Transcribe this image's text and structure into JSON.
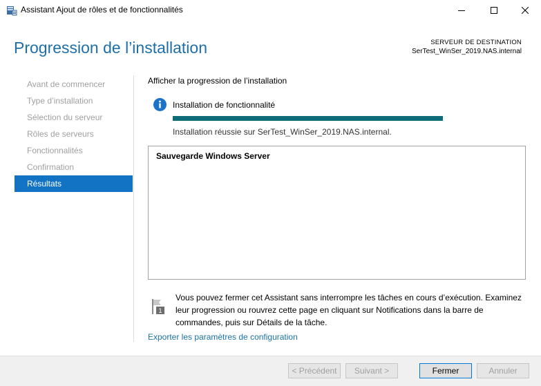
{
  "window": {
    "title": "Assistant Ajout de rôles et de fonctionnalités",
    "icons": {
      "app": "server-manager-icon",
      "minimize": "minimize-icon",
      "maximize": "maximize-icon",
      "close": "close-icon"
    }
  },
  "header": {
    "page_title": "Progression de l’installation",
    "destination_label": "SERVEUR DE DESTINATION",
    "destination_server": "SerTest_WinSer_2019.NAS.internal"
  },
  "nav": {
    "items": [
      {
        "label": "Avant de commencer"
      },
      {
        "label": "Type d’installation"
      },
      {
        "label": "Sélection du serveur"
      },
      {
        "label": "Rôles de serveurs"
      },
      {
        "label": "Fonctionnalités"
      },
      {
        "label": "Confirmation"
      },
      {
        "label": "Résultats"
      }
    ],
    "active_index": 6
  },
  "main": {
    "section_label": "Afficher la progression de l’installation",
    "status_label": "Installation de fonctionnalité",
    "progress": 1.0,
    "result_text": "Installation réussie sur SerTest_WinSer_2019.NAS.internal.",
    "results": [
      "Sauvegarde Windows Server"
    ],
    "note": "Vous pouvez fermer cet Assistant sans interrompre les tâches en cours d’exécution. Examinez leur progression ou rouvrez cette page en cliquant sur Notifications dans la barre de commandes, puis sur Détails de la tâche.",
    "note_badge": "1",
    "export_link": "Exporter les paramètres de configuration"
  },
  "footer": {
    "previous": "< Précédent",
    "next": "Suivant >",
    "close": "Fermer",
    "cancel": "Annuler"
  },
  "colors": {
    "accent_title": "#1e6fa8",
    "nav_active": "#1272c4",
    "progress": "#0f6d7a",
    "link": "#1b73a6"
  }
}
